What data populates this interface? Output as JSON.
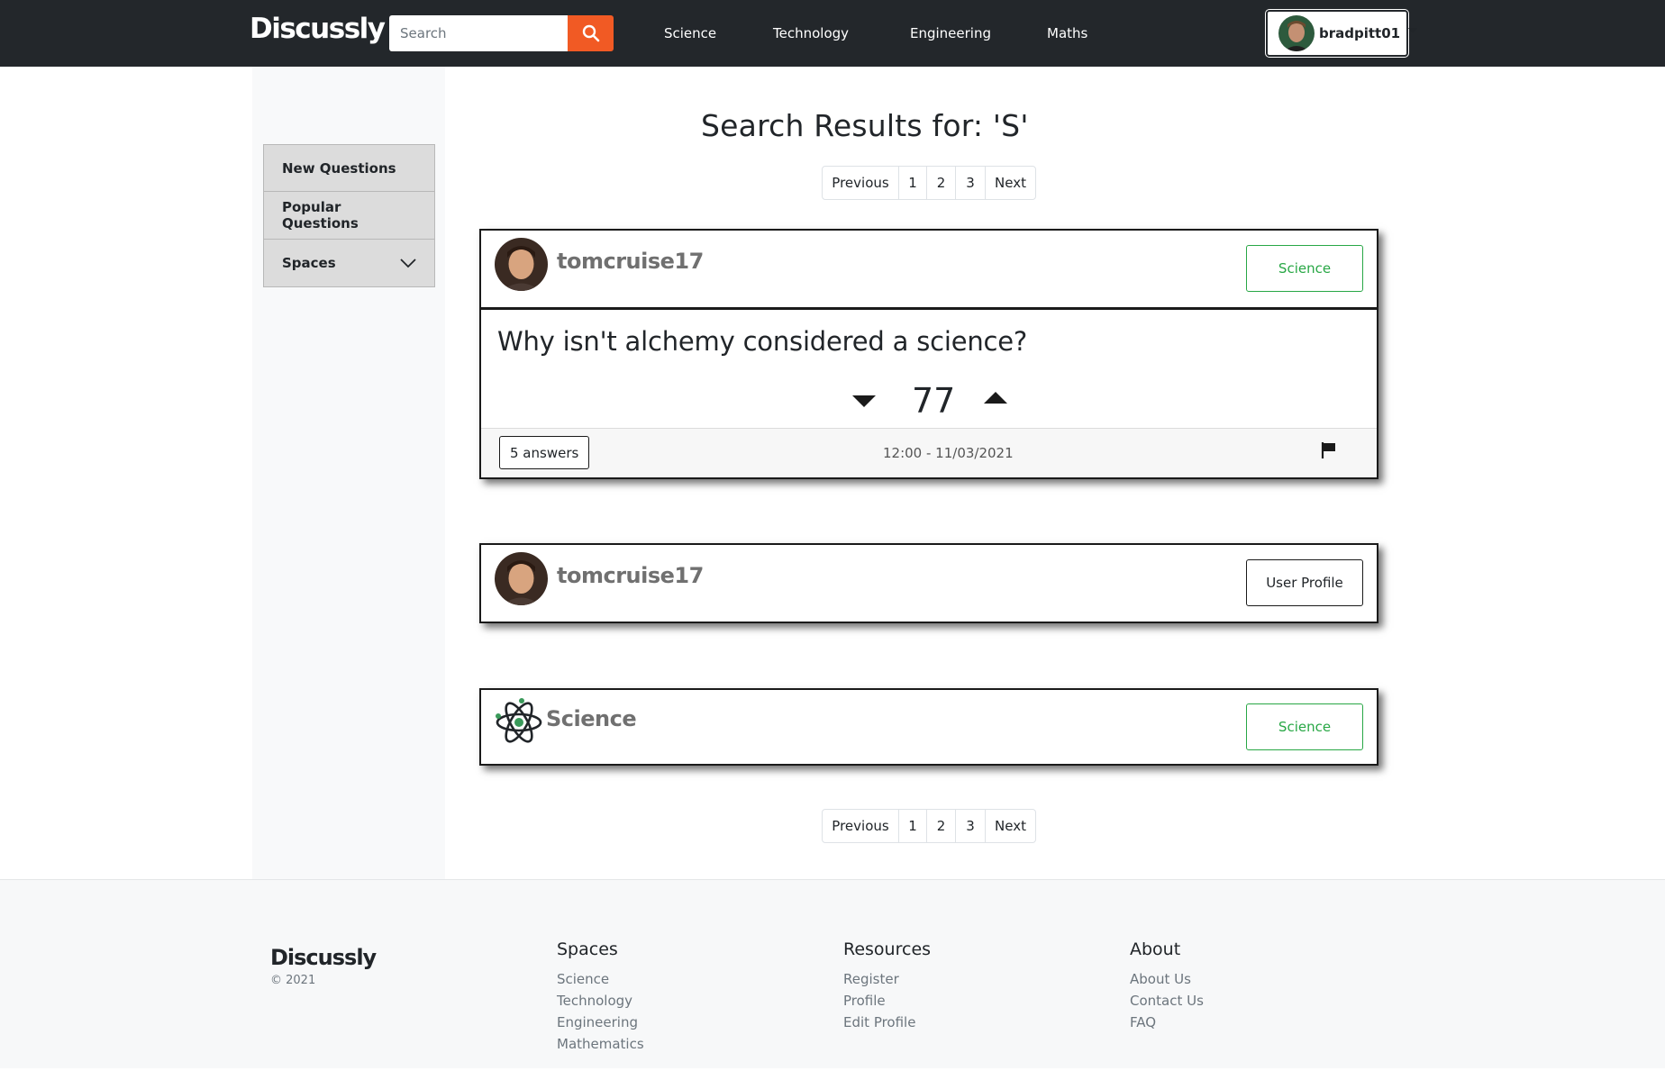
{
  "nav": {
    "brand": "Discussly",
    "search_placeholder": "Search",
    "links": [
      "Science",
      "Technology",
      "Engineering",
      "Maths"
    ],
    "user": "bradpitt01"
  },
  "sidebar": {
    "items": [
      {
        "label": "New Questions"
      },
      {
        "label": "Popular Questions"
      },
      {
        "label": "Spaces"
      }
    ]
  },
  "main": {
    "title": "Search Results for: 'S'",
    "pagination": {
      "previous": "Previous",
      "pages": [
        "1",
        "2",
        "3"
      ],
      "next": "Next"
    },
    "results": [
      {
        "type": "question",
        "username": "tomcruise17",
        "tag": "Science",
        "question": "Why isn't alchemy considered a science?",
        "votes": "77",
        "answers": "5 answers",
        "timestamp": "12:00 - 11/03/2021"
      },
      {
        "type": "user",
        "username": "tomcruise17",
        "button": "User Profile"
      },
      {
        "type": "space",
        "name": "Science",
        "button": "Science"
      }
    ]
  },
  "footer": {
    "brand": "Discussly",
    "copyright": "© 2021",
    "columns": [
      {
        "heading": "Spaces",
        "links": [
          "Science",
          "Technology",
          "Engineering",
          "Mathematics"
        ]
      },
      {
        "heading": "Resources",
        "links": [
          "Register",
          "Profile",
          "Edit Profile"
        ]
      },
      {
        "heading": "About",
        "links": [
          "About Us",
          "Contact Us",
          "FAQ"
        ]
      }
    ]
  },
  "colors": {
    "navbar": "#23272b",
    "accent": "#f15a24",
    "tag_green": "#28a745"
  }
}
